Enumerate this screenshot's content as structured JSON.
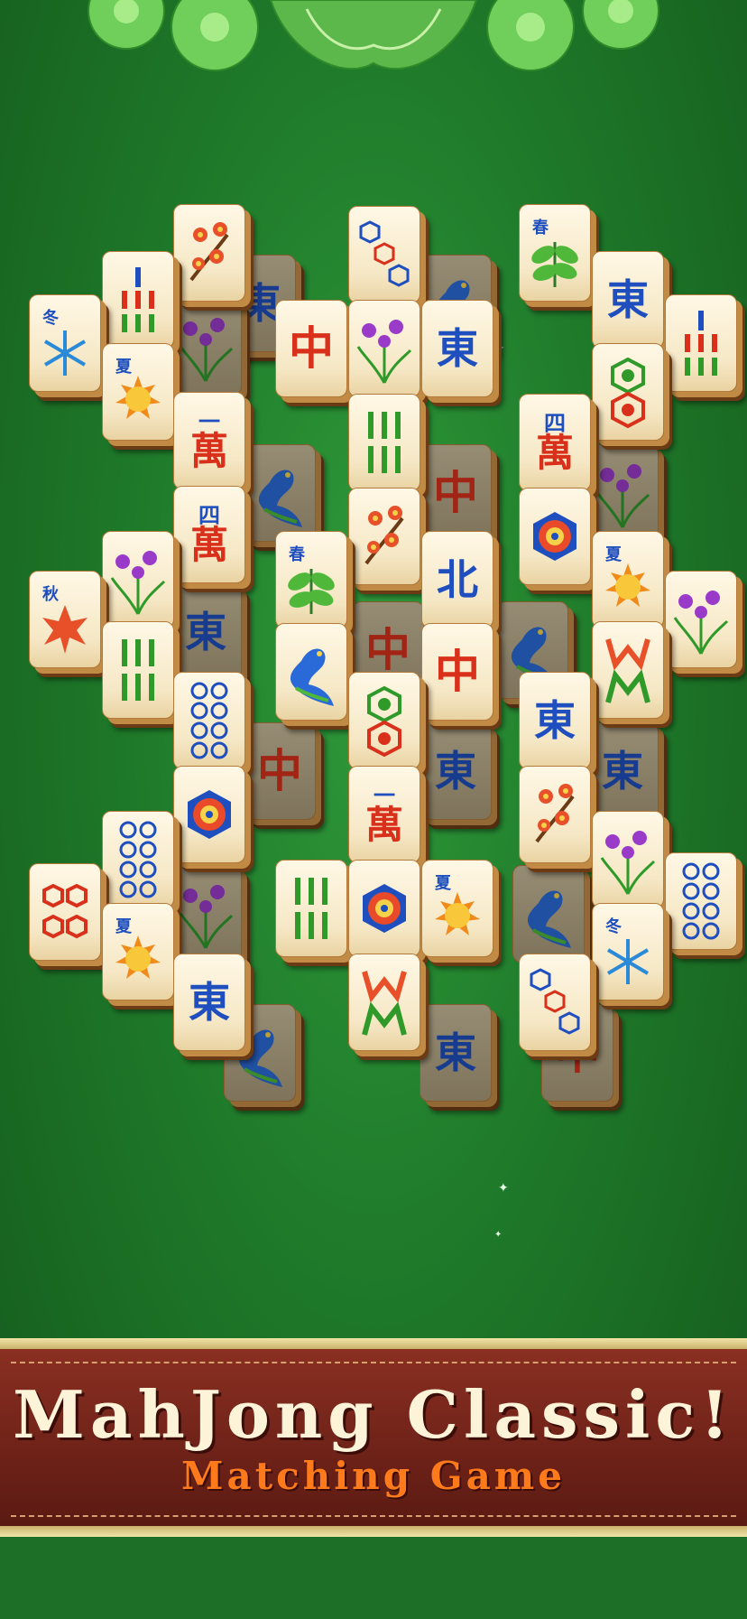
{
  "banner": {
    "title": "MahJong Classic!",
    "subtitle": "Matching Game"
  },
  "colors": {
    "felt_green": "#1f7a2a",
    "banner_red": "#7a281c",
    "title_cream": "#fdf3d8",
    "subtitle_orange": "#ff7a1a",
    "tile_face": "#fff8e6",
    "tile_edge": "#6b3b15"
  },
  "tiles": [
    {
      "name": "tile-bamboo-5",
      "face": "bamboo5"
    },
    {
      "name": "tile-flower-plum",
      "face": "plum"
    },
    {
      "name": "tile-dot-3",
      "face": "dot3"
    },
    {
      "name": "tile-season-spring-1",
      "face": "spring"
    },
    {
      "name": "tile-season-winter-1",
      "face": "winter"
    },
    {
      "name": "tile-season-summer-1",
      "face": "summer"
    },
    {
      "name": "tile-red-dragon-1",
      "face": "red-dragon"
    },
    {
      "name": "tile-flower-orchid-1",
      "face": "orchid"
    },
    {
      "name": "tile-east-wind-1",
      "face": "east"
    },
    {
      "name": "tile-east-wind-2",
      "face": "east"
    },
    {
      "name": "tile-bamboo-5b",
      "face": "bamboo5"
    },
    {
      "name": "tile-dot-2-green-red",
      "face": "dot2"
    },
    {
      "name": "tile-character-1",
      "face": "char1"
    },
    {
      "name": "tile-bamboo-6",
      "face": "bamboo6"
    },
    {
      "name": "tile-character-4",
      "face": "char4"
    }
  ]
}
